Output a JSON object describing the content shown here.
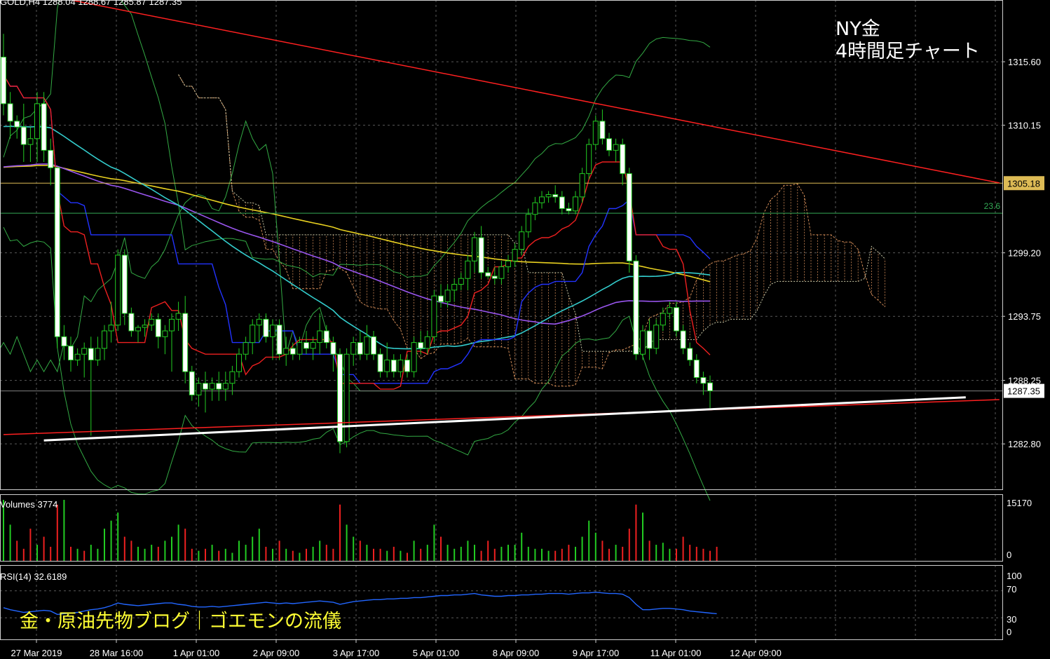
{
  "symbol_line": "GOLD,H4 1288.04 1288.67 1285.87 1287.35",
  "title_lines": [
    "NY金",
    "4時間足チャート"
  ],
  "blog_name": "金・原油先物ブログ｜ゴエモンの流儀",
  "colors": {
    "bg": "#000000",
    "grid": "#5a5a5a",
    "bull": "#000000",
    "bear": "#ffffff",
    "wick": "#22cc22",
    "trend": "#ff2020",
    "support": "#ffffff",
    "level": "#ddbb55",
    "fib": "#33aa55",
    "vol_up": "#22cc22",
    "vol_down": "#ee2020",
    "rsi": "#2266ff"
  },
  "chart_data": {
    "type": "candlestick",
    "title": "",
    "price_axis": {
      "ylim": [
        1278.9,
        1320.9
      ],
      "ticks": [
        "1315.60",
        "1310.15",
        "1299.20",
        "1293.75",
        "1288.25",
        "1282.80"
      ]
    },
    "x_tick_labels": [
      "27 Mar 2019",
      "28 Mar 16:00",
      "1 Apr 01:00",
      "2 Apr 09:00",
      "3 Apr 17:00",
      "5 Apr 01:00",
      "8 Apr 09:00",
      "9 Apr 17:00",
      "11 Apr 01:00",
      "12 Apr 09:00"
    ],
    "x_tick_index": [
      0,
      12,
      24,
      36,
      48,
      60,
      72,
      84,
      96,
      108
    ],
    "candles": [
      [
        1316.0,
        1318.0,
        1311.0,
        1312.0
      ],
      [
        1312.0,
        1313.0,
        1309.0,
        1310.5
      ],
      [
        1310.5,
        1311.0,
        1309.0,
        1310.0
      ],
      [
        1310.0,
        1312.0,
        1307.0,
        1308.5
      ],
      [
        1308.5,
        1310.0,
        1307.0,
        1309.0
      ],
      [
        1309.0,
        1313.0,
        1307.0,
        1312.0
      ],
      [
        1312.0,
        1313.0,
        1307.0,
        1308.0
      ],
      [
        1308.0,
        1309.0,
        1305.0,
        1306.5
      ],
      [
        1306.5,
        1306.0,
        1291.0,
        1292.0
      ],
      [
        1292.0,
        1293.0,
        1290.0,
        1291.2
      ],
      [
        1291.2,
        1292.0,
        1289.0,
        1290.0
      ],
      [
        1290.0,
        1291.0,
        1289.5,
        1290.5
      ],
      [
        1290.5,
        1291.5,
        1288.5,
        1291.0
      ],
      [
        1291.0,
        1292.0,
        1283.5,
        1290.0
      ],
      [
        1290.0,
        1292.0,
        1289.5,
        1291.0
      ],
      [
        1291.0,
        1293.0,
        1290.0,
        1292.5
      ],
      [
        1292.5,
        1295.0,
        1291.5,
        1293.0
      ],
      [
        1293.0,
        1299.5,
        1292.5,
        1299.0
      ],
      [
        1299.0,
        1299.5,
        1293.0,
        1294.0
      ],
      [
        1294.0,
        1294.5,
        1292.0,
        1292.5
      ],
      [
        1292.5,
        1293.0,
        1291.5,
        1292.8
      ],
      [
        1292.8,
        1293.5,
        1292.0,
        1293.0
      ],
      [
        1293.0,
        1294.0,
        1292.5,
        1293.5
      ],
      [
        1293.5,
        1294.0,
        1291.0,
        1292.0
      ],
      [
        1292.0,
        1293.0,
        1290.5,
        1292.5
      ],
      [
        1292.5,
        1294.0,
        1289.0,
        1293.5
      ],
      [
        1293.5,
        1295.0,
        1292.5,
        1294.0
      ],
      [
        1294.0,
        1295.5,
        1288.0,
        1289.0
      ],
      [
        1289.0,
        1289.5,
        1286.5,
        1287.0
      ],
      [
        1287.0,
        1288.5,
        1286.0,
        1288.0
      ],
      [
        1288.0,
        1289.0,
        1285.5,
        1287.5
      ],
      [
        1287.5,
        1288.5,
        1286.5,
        1288.0
      ],
      [
        1288.0,
        1289.0,
        1286.5,
        1287.5
      ],
      [
        1287.5,
        1289.0,
        1286.5,
        1288.0
      ],
      [
        1288.0,
        1289.5,
        1287.0,
        1289.0
      ],
      [
        1289.0,
        1291.0,
        1288.5,
        1290.5
      ],
      [
        1290.5,
        1292.0,
        1290.0,
        1291.5
      ],
      [
        1291.5,
        1293.5,
        1290.5,
        1293.0
      ],
      [
        1293.0,
        1294.0,
        1291.5,
        1293.5
      ],
      [
        1293.5,
        1294.0,
        1291.5,
        1292.0
      ],
      [
        1292.0,
        1293.5,
        1290.0,
        1293.0
      ],
      [
        1293.0,
        1293.5,
        1290.0,
        1290.5
      ],
      [
        1290.5,
        1292.0,
        1289.5,
        1291.0
      ],
      [
        1291.0,
        1291.5,
        1290.0,
        1290.5
      ],
      [
        1290.5,
        1292.0,
        1290.0,
        1291.5
      ],
      [
        1291.5,
        1292.5,
        1290.5,
        1291.0
      ],
      [
        1291.0,
        1292.0,
        1290.0,
        1291.5
      ],
      [
        1291.5,
        1294.0,
        1290.5,
        1292.5
      ],
      [
        1292.5,
        1293.0,
        1291.0,
        1291.5
      ],
      [
        1291.5,
        1292.0,
        1289.0,
        1290.5
      ],
      [
        1290.5,
        1291.0,
        1282.0,
        1283.0
      ],
      [
        1283.0,
        1291.0,
        1282.5,
        1290.5
      ],
      [
        1290.5,
        1292.0,
        1289.5,
        1291.5
      ],
      [
        1291.5,
        1292.5,
        1290.0,
        1290.5
      ],
      [
        1290.5,
        1293.0,
        1290.0,
        1292.0
      ],
      [
        1292.0,
        1292.5,
        1290.0,
        1290.5
      ],
      [
        1290.5,
        1291.0,
        1288.5,
        1289.0
      ],
      [
        1289.0,
        1291.5,
        1288.5,
        1290.0
      ],
      [
        1290.0,
        1290.5,
        1288.5,
        1289.0
      ],
      [
        1289.0,
        1290.5,
        1288.5,
        1290.0
      ],
      [
        1290.0,
        1290.5,
        1288.5,
        1289.0
      ],
      [
        1289.0,
        1292.0,
        1288.5,
        1291.5
      ],
      [
        1291.5,
        1292.5,
        1290.5,
        1291.0
      ],
      [
        1291.0,
        1292.5,
        1290.5,
        1292.0
      ],
      [
        1292.0,
        1296.0,
        1291.5,
        1295.5
      ],
      [
        1295.5,
        1296.5,
        1294.5,
        1295.0
      ],
      [
        1295.0,
        1296.5,
        1294.5,
        1296.0
      ],
      [
        1296.0,
        1297.0,
        1295.0,
        1296.5
      ],
      [
        1296.5,
        1297.5,
        1296.0,
        1297.0
      ],
      [
        1297.0,
        1299.0,
        1296.0,
        1298.5
      ],
      [
        1298.5,
        1301.0,
        1297.5,
        1300.5
      ],
      [
        1300.5,
        1301.5,
        1297.0,
        1297.5
      ],
      [
        1297.5,
        1298.0,
        1297.0,
        1297.2
      ],
      [
        1297.2,
        1298.0,
        1296.5,
        1297.0
      ],
      [
        1297.0,
        1298.5,
        1296.5,
        1298.0
      ],
      [
        1298.0,
        1299.0,
        1297.5,
        1298.5
      ],
      [
        1298.5,
        1300.0,
        1298.0,
        1299.5
      ],
      [
        1299.5,
        1301.5,
        1299.0,
        1301.0
      ],
      [
        1301.0,
        1303.0,
        1300.5,
        1302.5
      ],
      [
        1302.5,
        1304.0,
        1302.0,
        1303.5
      ],
      [
        1303.5,
        1304.5,
        1303.0,
        1304.0
      ],
      [
        1304.0,
        1304.5,
        1303.5,
        1304.2
      ],
      [
        1304.2,
        1305.0,
        1303.5,
        1304.0
      ],
      [
        1304.0,
        1304.5,
        1302.5,
        1303.0
      ],
      [
        1303.0,
        1303.5,
        1302.5,
        1302.8
      ],
      [
        1302.8,
        1304.5,
        1302.5,
        1304.0
      ],
      [
        1304.0,
        1306.5,
        1303.5,
        1306.0
      ],
      [
        1306.0,
        1309.0,
        1305.5,
        1308.5
      ],
      [
        1308.5,
        1311.0,
        1308.0,
        1310.5
      ],
      [
        1310.5,
        1311.5,
        1308.5,
        1309.0
      ],
      [
        1309.0,
        1309.5,
        1307.5,
        1308.0
      ],
      [
        1308.0,
        1309.0,
        1307.0,
        1308.5
      ],
      [
        1308.5,
        1309.0,
        1305.0,
        1306.0
      ],
      [
        1306.0,
        1306.5,
        1297.5,
        1298.5
      ],
      [
        1298.5,
        1299.0,
        1290.0,
        1290.5
      ],
      [
        1290.5,
        1293.0,
        1290.0,
        1292.5
      ],
      [
        1292.5,
        1293.5,
        1290.0,
        1291.0
      ],
      [
        1291.0,
        1293.5,
        1290.5,
        1293.0
      ],
      [
        1293.0,
        1294.5,
        1292.5,
        1294.0
      ],
      [
        1294.0,
        1295.0,
        1293.5,
        1294.5
      ],
      [
        1294.5,
        1295.0,
        1292.0,
        1292.5
      ],
      [
        1292.5,
        1293.0,
        1290.5,
        1291.0
      ],
      [
        1291.0,
        1291.5,
        1289.5,
        1290.0
      ],
      [
        1290.0,
        1290.5,
        1288.0,
        1288.5
      ],
      [
        1288.5,
        1289.0,
        1287.0,
        1288.0
      ],
      [
        1288.04,
        1288.67,
        1285.87,
        1287.35
      ]
    ],
    "horizontal_levels": [
      {
        "price": 1305.18,
        "label": "1305.18",
        "color": "#ddbb55"
      },
      {
        "price": 1302.6,
        "label": "23.6",
        "color": "#33aa55"
      },
      {
        "price": 1287.35,
        "label": "1287.35",
        "color": "#7f7f7f"
      }
    ],
    "trendlines": [
      {
        "color": "#ff2020",
        "points": [
          [
            10,
            1320.9
          ],
          [
            148,
            1305.2
          ]
        ]
      },
      {
        "color": "#ff2020",
        "points": [
          [
            0,
            1283.6
          ],
          [
            148,
            1286.6
          ]
        ]
      },
      {
        "color": "#ffffff",
        "points": [
          [
            6,
            1283.1
          ],
          [
            143,
            1286.8
          ]
        ]
      }
    ],
    "volume": {
      "label": "Volumes 3774",
      "ticks": [
        "15170",
        "0"
      ],
      "max": 15170,
      "values": [
        15170,
        9000,
        5000,
        3000,
        8000,
        4000,
        6000,
        3500,
        14000,
        15170,
        3500,
        3000,
        2500,
        4000,
        3000,
        8000,
        10000,
        12000,
        6000,
        5000,
        3500,
        3000,
        4000,
        3500,
        5000,
        6000,
        9000,
        8000,
        3000,
        2500,
        3000,
        4000,
        2500,
        3000,
        2000,
        5000,
        4000,
        6000,
        8000,
        3500,
        3000,
        5000,
        3000,
        2500,
        2000,
        3000,
        3500,
        5000,
        4000,
        3000,
        14000,
        9000,
        6000,
        5000,
        4000,
        3000,
        3000,
        2500,
        3500,
        2500,
        2000,
        5000,
        3000,
        4000,
        9000,
        6000,
        4000,
        3000,
        3500,
        5000,
        4000,
        2500,
        5000,
        3000,
        3500,
        4000,
        4000,
        7000,
        3500,
        3000,
        3000,
        2500,
        2500,
        3000,
        4000,
        3500,
        6000,
        10000,
        7000,
        5000,
        3000,
        4000,
        3500,
        8000,
        14000,
        12000,
        5000,
        4000,
        4500,
        3000,
        3000,
        6000,
        4000,
        3500,
        3000,
        2500,
        3500
      ],
      "dir": [
        1,
        1,
        0,
        0,
        0,
        1,
        0,
        0,
        0,
        1,
        0,
        1,
        0,
        1,
        1,
        1,
        1,
        1,
        0,
        0,
        1,
        1,
        1,
        0,
        1,
        1,
        1,
        0,
        0,
        1,
        0,
        1,
        0,
        1,
        1,
        1,
        1,
        1,
        1,
        0,
        1,
        0,
        1,
        0,
        1,
        0,
        1,
        1,
        0,
        0,
        0,
        1,
        1,
        0,
        1,
        0,
        0,
        1,
        0,
        1,
        0,
        1,
        0,
        1,
        1,
        0,
        1,
        1,
        1,
        1,
        1,
        0,
        0,
        0,
        1,
        1,
        1,
        1,
        1,
        1,
        1,
        1,
        0,
        0,
        0,
        1,
        1,
        1,
        1,
        0,
        0,
        1,
        0,
        0,
        0,
        1,
        0,
        1,
        1,
        1,
        0,
        0,
        0,
        0,
        0,
        0,
        0
      ]
    },
    "rsi": {
      "label": "RSI(14) 32.6189",
      "ticks": [
        "100",
        "70",
        "30",
        "0"
      ],
      "values": [
        45,
        42,
        40,
        38,
        39,
        40,
        41,
        40,
        35,
        36,
        37,
        38,
        40,
        42,
        43,
        45,
        48,
        52,
        50,
        49,
        48,
        49,
        50,
        51,
        52,
        52,
        50,
        49,
        47,
        46,
        46,
        47,
        46,
        47,
        48,
        49,
        50,
        51,
        52,
        53,
        52,
        51,
        52,
        51,
        52,
        53,
        54,
        55,
        54,
        53,
        50,
        52,
        54,
        55,
        56,
        57,
        57,
        58,
        58,
        59,
        59,
        60,
        60,
        61,
        62,
        63,
        63,
        64,
        64,
        65,
        66,
        64,
        63,
        62,
        62,
        63,
        63,
        64,
        64,
        65,
        65,
        66,
        66,
        66,
        65,
        66,
        67,
        67,
        68,
        67,
        66,
        66,
        65,
        60,
        50,
        42,
        42,
        43,
        44,
        44,
        43,
        42,
        40,
        39,
        38,
        37,
        36
      ]
    }
  }
}
